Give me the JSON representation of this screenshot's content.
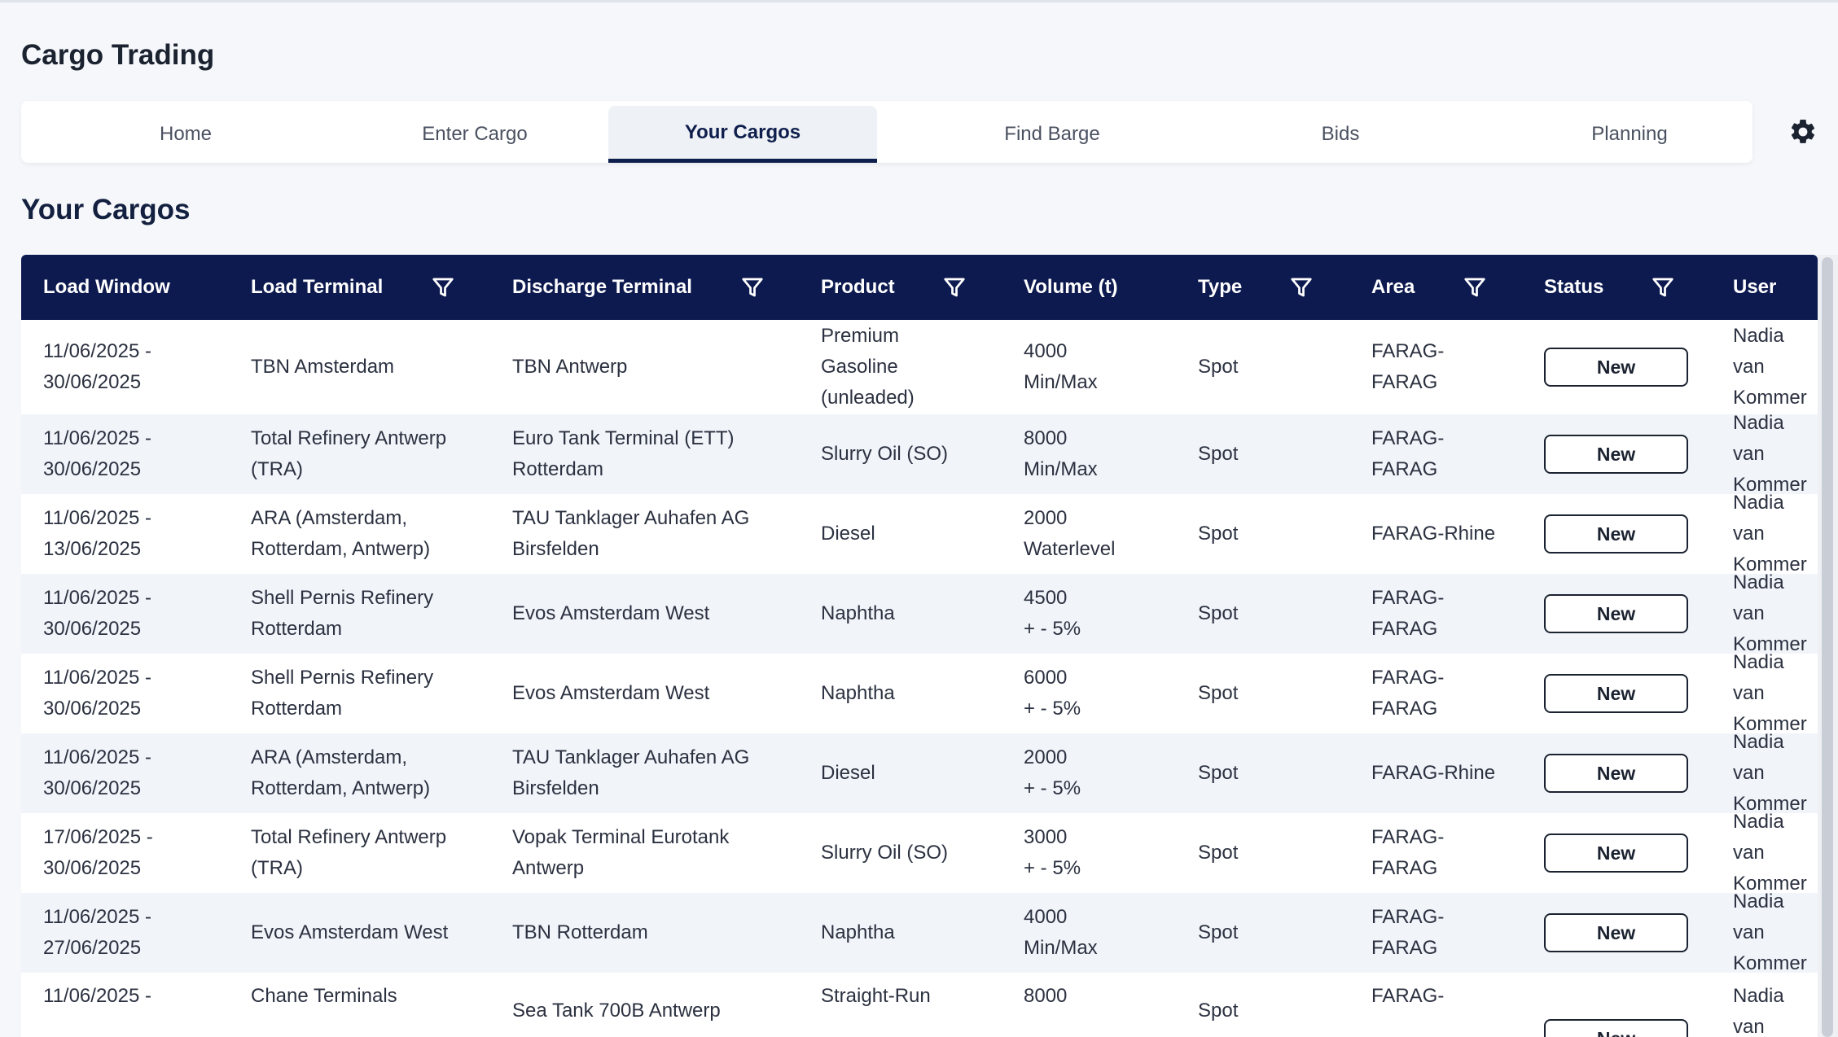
{
  "app": {
    "title": "Cargo Trading"
  },
  "tabs": [
    {
      "label": "Home",
      "active": false
    },
    {
      "label": "Enter Cargo",
      "active": false
    },
    {
      "label": "Your Cargos",
      "active": true
    },
    {
      "label": "Find Barge",
      "active": false
    },
    {
      "label": "Bids",
      "active": false
    },
    {
      "label": "Planning",
      "active": false
    }
  ],
  "page": {
    "title": "Your Cargos"
  },
  "table": {
    "columns": [
      {
        "label": "Load Window",
        "filter": false
      },
      {
        "label": "Load Terminal",
        "filter": true
      },
      {
        "label": "Discharge Terminal",
        "filter": true
      },
      {
        "label": "Product",
        "filter": true
      },
      {
        "label": "Volume (t)",
        "filter": false
      },
      {
        "label": "Type",
        "filter": true
      },
      {
        "label": "Area",
        "filter": true
      },
      {
        "label": "Status",
        "filter": true
      },
      {
        "label": "User",
        "filter": false
      }
    ],
    "rows": [
      {
        "load_window": "11/06/2025 -\n30/06/2025",
        "load_terminal": "TBN Amsterdam",
        "discharge_terminal": "TBN Antwerp",
        "product": "Premium\nGasoline\n(unleaded)",
        "volume": "4000\nMin/Max",
        "type": "Spot",
        "area": "FARAG-\nFARAG",
        "status": "New",
        "user": "Nadia van\nKommer"
      },
      {
        "load_window": "11/06/2025 -\n30/06/2025",
        "load_terminal": "Total Refinery Antwerp\n(TRA)",
        "discharge_terminal": "Euro Tank Terminal (ETT)\nRotterdam",
        "product": "Slurry Oil (SO)",
        "volume": "8000\nMin/Max",
        "type": "Spot",
        "area": "FARAG-\nFARAG",
        "status": "New",
        "user": "Nadia van\nKommer"
      },
      {
        "load_window": "11/06/2025 -\n13/06/2025",
        "load_terminal": "ARA (Amsterdam,\nRotterdam, Antwerp)",
        "discharge_terminal": "TAU Tanklager Auhafen AG\nBirsfelden",
        "product": "Diesel",
        "volume": "2000\nWaterlevel",
        "type": "Spot",
        "area": "FARAG-Rhine",
        "status": "New",
        "user": "Nadia van\nKommer"
      },
      {
        "load_window": "11/06/2025 -\n30/06/2025",
        "load_terminal": "Shell Pernis Refinery\nRotterdam",
        "discharge_terminal": "Evos Amsterdam West",
        "product": "Naphtha",
        "volume": "4500\n+ - 5%",
        "type": "Spot",
        "area": "FARAG-\nFARAG",
        "status": "New",
        "user": "Nadia van\nKommer"
      },
      {
        "load_window": "11/06/2025 -\n30/06/2025",
        "load_terminal": "Shell Pernis Refinery\nRotterdam",
        "discharge_terminal": "Evos Amsterdam West",
        "product": "Naphtha",
        "volume": "6000\n+ - 5%",
        "type": "Spot",
        "area": "FARAG-\nFARAG",
        "status": "New",
        "user": "Nadia van\nKommer"
      },
      {
        "load_window": "11/06/2025 -\n30/06/2025",
        "load_terminal": "ARA (Amsterdam,\nRotterdam, Antwerp)",
        "discharge_terminal": "TAU Tanklager Auhafen AG\nBirsfelden",
        "product": "Diesel",
        "volume": "2000\n+ - 5%",
        "type": "Spot",
        "area": "FARAG-Rhine",
        "status": "New",
        "user": "Nadia van\nKommer"
      },
      {
        "load_window": "17/06/2025 -\n30/06/2025",
        "load_terminal": "Total Refinery Antwerp\n(TRA)",
        "discharge_terminal": "Vopak Terminal Eurotank\nAntwerp",
        "product": "Slurry Oil (SO)",
        "volume": "3000\n+ - 5%",
        "type": "Spot",
        "area": "FARAG-\nFARAG",
        "status": "New",
        "user": "Nadia van\nKommer"
      },
      {
        "load_window": "11/06/2025 -\n27/06/2025",
        "load_terminal": "Evos Amsterdam West",
        "discharge_terminal": "TBN Rotterdam",
        "product": "Naphtha",
        "volume": "4000\nMin/Max",
        "type": "Spot",
        "area": "FARAG-\nFARAG",
        "status": "New",
        "user": "Nadia van\nKommer"
      },
      {
        "load_window": "11/06/2025 -",
        "load_terminal": "Chane Terminals",
        "discharge_terminal": "Sea Tank 700B Antwerp",
        "product": "Straight-Run",
        "volume": "8000",
        "type": "Spot",
        "area": "FARAG-",
        "status": "New",
        "user": "Nadia van"
      }
    ]
  },
  "colors": {
    "header_bg": "#0d1a4f",
    "accent": "#0f1f4d",
    "row_alt": "#f1f4f9",
    "page_bg": "#f5f7fb"
  },
  "icons": {
    "settings": "gear-icon",
    "column_filter": "filter-icon"
  }
}
